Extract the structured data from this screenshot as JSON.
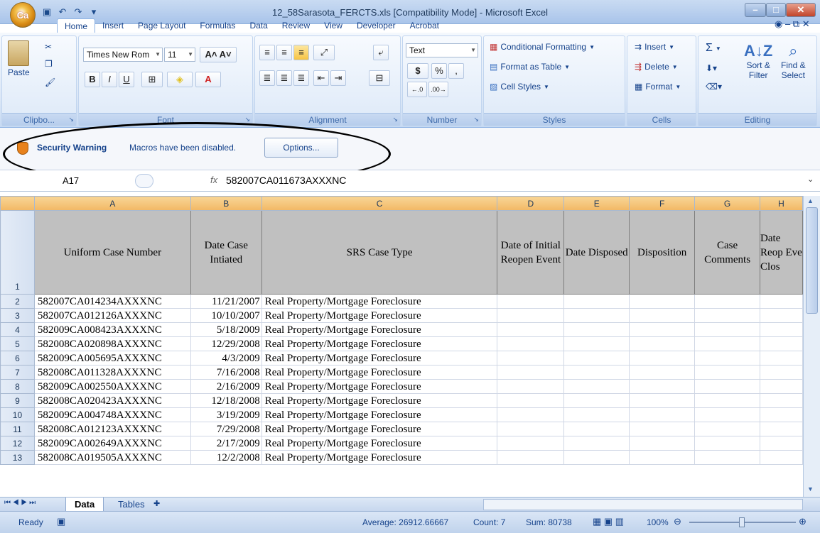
{
  "window": {
    "title": "12_58Sarasota_FERCTS.xls  [Compatibility Mode] - Microsoft Excel",
    "office_button_label": "Ca"
  },
  "tabs": [
    "Home",
    "Insert",
    "Page Layout",
    "Formulas",
    "Data",
    "Review",
    "View",
    "Developer",
    "Acrobat"
  ],
  "ribbon": {
    "clipboard": {
      "paste": "Paste",
      "label": "Clipbo..."
    },
    "font": {
      "name": "Times New Rom",
      "size": "11",
      "bold": "B",
      "italic": "I",
      "underline": "U",
      "label": "Font"
    },
    "alignment": {
      "label": "Alignment"
    },
    "number": {
      "format": "Text",
      "currency": "$",
      "percent": "%",
      "comma": ",",
      "label": "Number"
    },
    "styles": {
      "conditional": "Conditional Formatting",
      "format_table": "Format as Table",
      "cell_styles": "Cell Styles",
      "label": "Styles"
    },
    "cells": {
      "insert": "Insert",
      "delete": "Delete",
      "format": "Format",
      "label": "Cells"
    },
    "editing": {
      "sum": "Σ",
      "sort": "Sort &",
      "sort2": "Filter",
      "find": "Find &",
      "find2": "Select",
      "label": "Editing"
    }
  },
  "security": {
    "title": "Security Warning",
    "message": "Macros have been disabled.",
    "button": "Options..."
  },
  "formula": {
    "name_box": "A17",
    "fx": "fx",
    "value": "582007CA011673AXXXNC"
  },
  "columns": [
    "A",
    "B",
    "C",
    "D",
    "E",
    "F",
    "G",
    "H"
  ],
  "header_row": {
    "num": "1",
    "cells": [
      "Uniform Case Number",
      "Date Case Intiated",
      "SRS Case Type",
      "Date of Initial Reopen Event",
      "Date Disposed",
      "Disposition",
      "Case Comments",
      "Date Reop Eve Clos"
    ]
  },
  "rows": [
    {
      "num": "2",
      "case": "582007CA014234AXXXNC",
      "date": "11/21/2007",
      "type": "Real Property/Mortgage Foreclosure"
    },
    {
      "num": "3",
      "case": "582007CA012126AXXXNC",
      "date": "10/10/2007",
      "type": "Real Property/Mortgage Foreclosure"
    },
    {
      "num": "4",
      "case": "582009CA008423AXXXNC",
      "date": "5/18/2009",
      "type": "Real Property/Mortgage Foreclosure"
    },
    {
      "num": "5",
      "case": "582008CA020898AXXXNC",
      "date": "12/29/2008",
      "type": "Real Property/Mortgage Foreclosure"
    },
    {
      "num": "6",
      "case": "582009CA005695AXXXNC",
      "date": "4/3/2009",
      "type": "Real Property/Mortgage Foreclosure"
    },
    {
      "num": "7",
      "case": "582008CA011328AXXXNC",
      "date": "7/16/2008",
      "type": "Real Property/Mortgage Foreclosure"
    },
    {
      "num": "8",
      "case": "582009CA002550AXXXNC",
      "date": "2/16/2009",
      "type": "Real Property/Mortgage Foreclosure"
    },
    {
      "num": "9",
      "case": "582008CA020423AXXXNC",
      "date": "12/18/2008",
      "type": "Real Property/Mortgage Foreclosure"
    },
    {
      "num": "10",
      "case": "582009CA004748AXXXNC",
      "date": "3/19/2009",
      "type": "Real Property/Mortgage Foreclosure"
    },
    {
      "num": "11",
      "case": "582008CA012123AXXXNC",
      "date": "7/29/2008",
      "type": "Real Property/Mortgage Foreclosure"
    },
    {
      "num": "12",
      "case": "582009CA002649AXXXNC",
      "date": "2/17/2009",
      "type": "Real Property/Mortgage Foreclosure"
    },
    {
      "num": "13",
      "case": "582008CA019505AXXXNC",
      "date": "12/2/2008",
      "type": "Real Property/Mortgage Foreclosure"
    }
  ],
  "sheets": {
    "active": "Data",
    "other": "Tables"
  },
  "status": {
    "ready": "Ready",
    "average": "Average: 26912.66667",
    "count": "Count: 7",
    "sum": "Sum: 80738",
    "zoom": "100%"
  },
  "colors": {
    "accent": "#15428b",
    "header_fill": "#c0c0c0",
    "col_header": "#f2b865"
  }
}
